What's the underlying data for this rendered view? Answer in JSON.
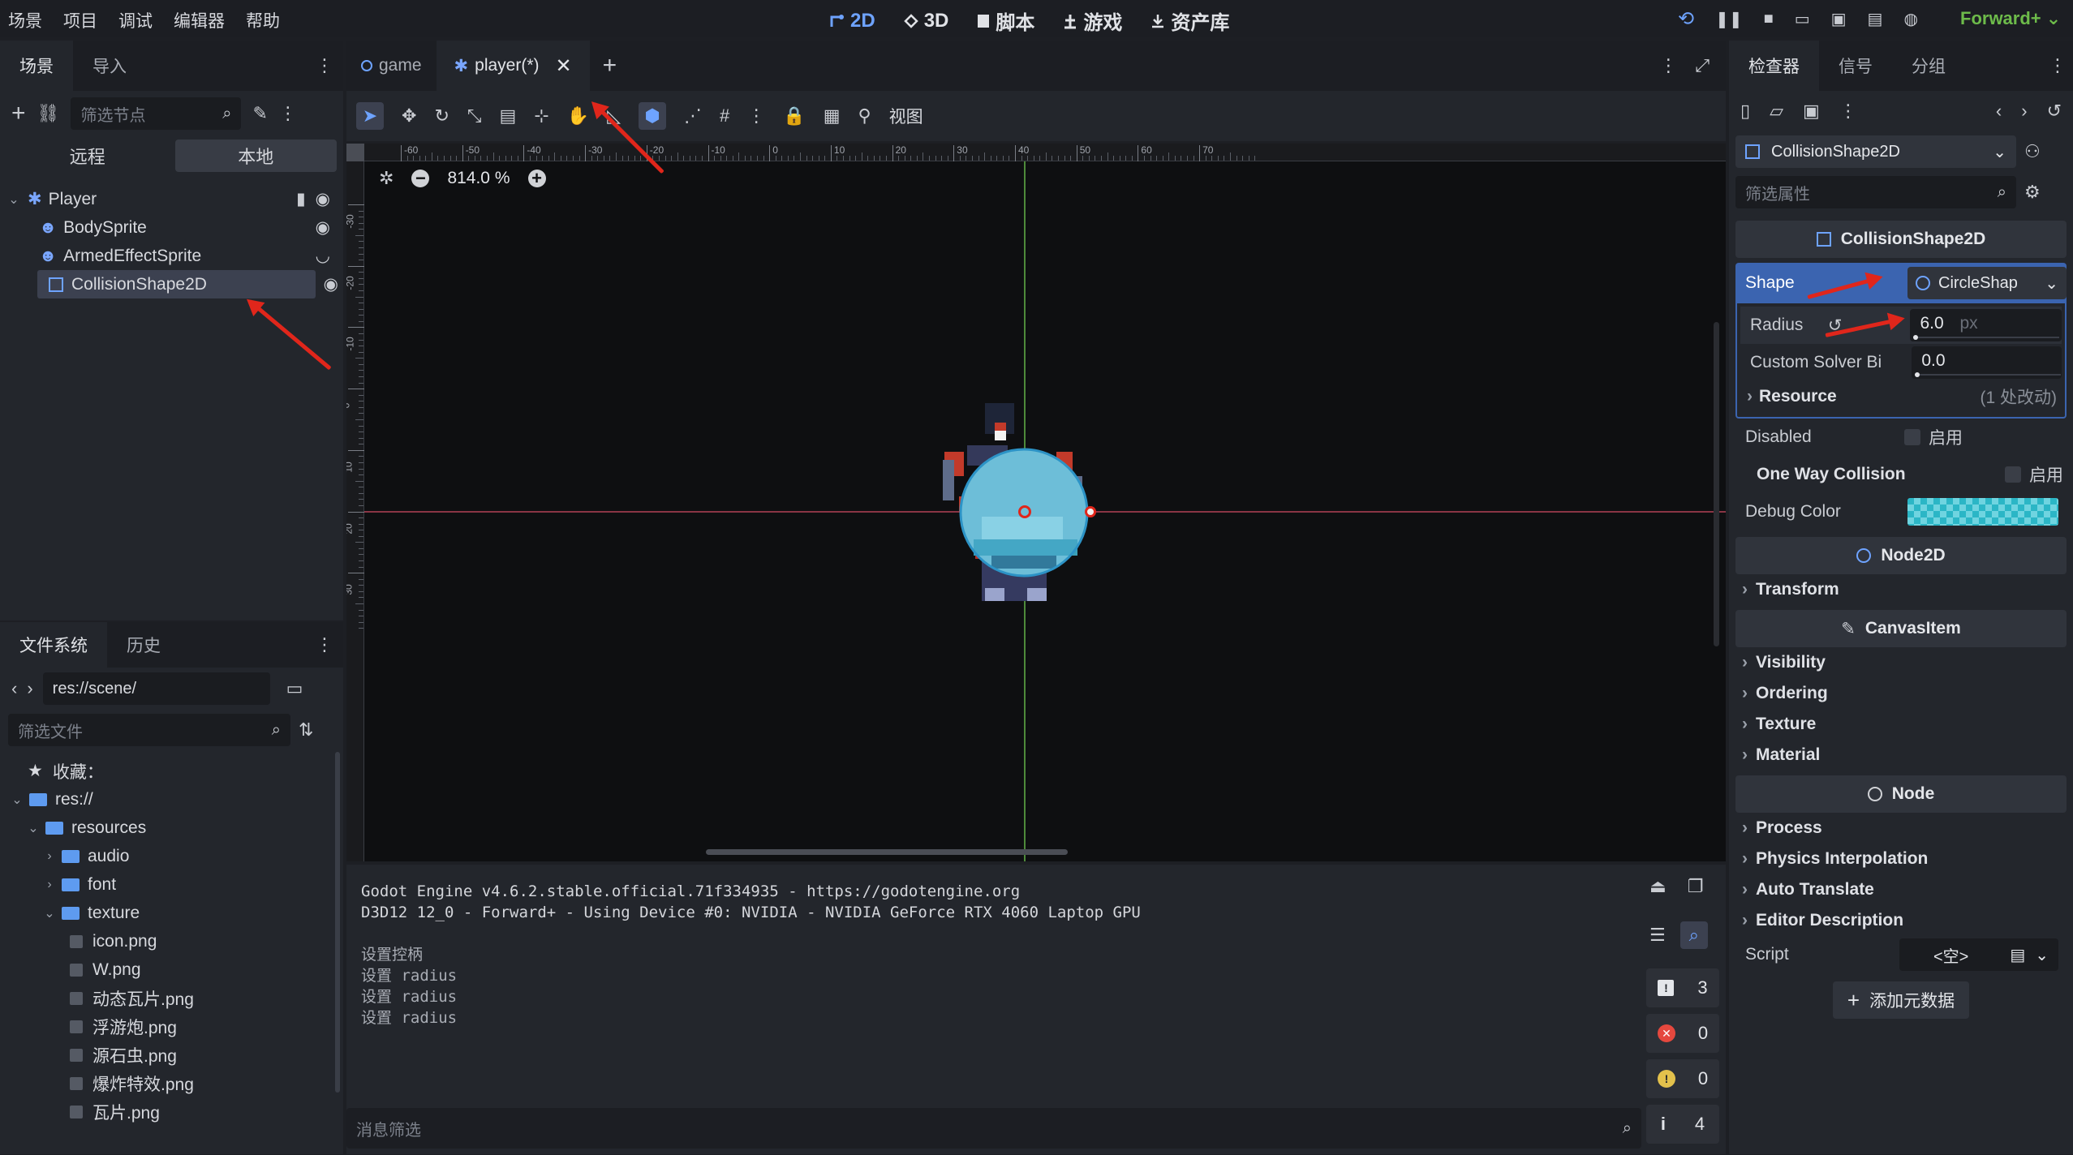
{
  "menu": [
    "场景",
    "项目",
    "调试",
    "编辑器",
    "帮助"
  ],
  "modes": [
    {
      "label": "2D",
      "icon": "2d-icon",
      "active": true
    },
    {
      "label": "3D",
      "icon": "3d-icon",
      "active": false
    },
    {
      "label": "脚本",
      "icon": "script-icon",
      "active": false
    },
    {
      "label": "游戏",
      "icon": "game-icon",
      "active": false
    },
    {
      "label": "资产库",
      "icon": "assetlib-icon",
      "active": false
    }
  ],
  "renderer": "Forward+",
  "scene_dock": {
    "tabs": [
      "场景",
      "导入"
    ],
    "filter_placeholder": "筛选节点",
    "remote": "远程",
    "local": "本地",
    "nodes": [
      {
        "label": "Player",
        "icon": "player-node-icon"
      },
      {
        "label": "BodySprite",
        "icon": "sprite-icon"
      },
      {
        "label": "ArmedEffectSprite",
        "icon": "sprite-icon"
      },
      {
        "label": "CollisionShape2D",
        "icon": "collision-shape-icon"
      }
    ]
  },
  "filesystem": {
    "tabs": [
      "文件系统",
      "历史"
    ],
    "path": "res://scene/",
    "filter_placeholder": "筛选文件",
    "favorites": "收藏：",
    "items": [
      {
        "label": "res://",
        "depth": 0,
        "type": "folder"
      },
      {
        "label": "resources",
        "depth": 1,
        "type": "folder"
      },
      {
        "label": "audio",
        "depth": 2,
        "type": "folder"
      },
      {
        "label": "font",
        "depth": 2,
        "type": "folder"
      },
      {
        "label": "texture",
        "depth": 2,
        "type": "folder"
      },
      {
        "label": "icon.png",
        "depth": 3,
        "type": "file"
      },
      {
        "label": "W.png",
        "depth": 3,
        "type": "file"
      },
      {
        "label": "动态瓦片.png",
        "depth": 3,
        "type": "file"
      },
      {
        "label": "浮游炮.png",
        "depth": 3,
        "type": "file"
      },
      {
        "label": "源石虫.png",
        "depth": 3,
        "type": "file"
      },
      {
        "label": "爆炸特效.png",
        "depth": 3,
        "type": "file"
      },
      {
        "label": "瓦片.png",
        "depth": 3,
        "type": "file"
      }
    ]
  },
  "editor_tabs": [
    {
      "label": "game",
      "active": false
    },
    {
      "label": "player(*)",
      "active": true
    }
  ],
  "toolbar": {
    "view": "视图"
  },
  "viewport": {
    "zoom": "814.0 %",
    "ruler_top": [
      "-60",
      "-50",
      "-40",
      "-30",
      "-20",
      "-10",
      "0",
      "10",
      "20",
      "30",
      "40",
      "50",
      "60",
      "70"
    ],
    "ruler_left": [
      "-30",
      "-20",
      "-10",
      "0",
      "10",
      "20",
      "30"
    ]
  },
  "output": {
    "lines": [
      "Godot Engine v4.6.2.stable.official.71f334935 - https://godotengine.org",
      "D3D12 12_0 - Forward+ - Using Device #0: NVIDIA - NVIDIA GeForce RTX 4060 Laptop GPU",
      "",
      "设置控柄",
      "设置 radius",
      "设置 radius",
      "设置 radius"
    ],
    "filter_placeholder": "消息筛选",
    "counts": {
      "messages": "3",
      "errors": "0",
      "warnings": "0",
      "info": "4"
    }
  },
  "inspector": {
    "tabs": [
      "检查器",
      "信号",
      "分组"
    ],
    "node_selector": "CollisionShape2D",
    "filter_placeholder": "筛选属性",
    "section_collision": "CollisionShape2D",
    "shape_label": "Shape",
    "shape_value": "CircleShap",
    "radius_label": "Radius",
    "radius_value": "6.0",
    "radius_unit": "px",
    "solver_label": "Custom Solver Bi",
    "solver_value": "0.0",
    "resource_label": "Resource",
    "resource_changes": "(1 处改动)",
    "disabled_label": "Disabled",
    "enable": "启用",
    "oneway_label": "One Way Collision",
    "debug_color_label": "Debug Color",
    "section_node2d": "Node2D",
    "transform": "Transform",
    "section_canvas": "CanvasItem",
    "canvas_cats": [
      "Visibility",
      "Ordering",
      "Texture",
      "Material"
    ],
    "section_node": "Node",
    "node_cats": [
      "Process",
      "Physics Interpolation",
      "Auto Translate",
      "Editor Description"
    ],
    "script_label": "Script",
    "script_value": "<空>",
    "add_metadata": "添加元数据"
  }
}
